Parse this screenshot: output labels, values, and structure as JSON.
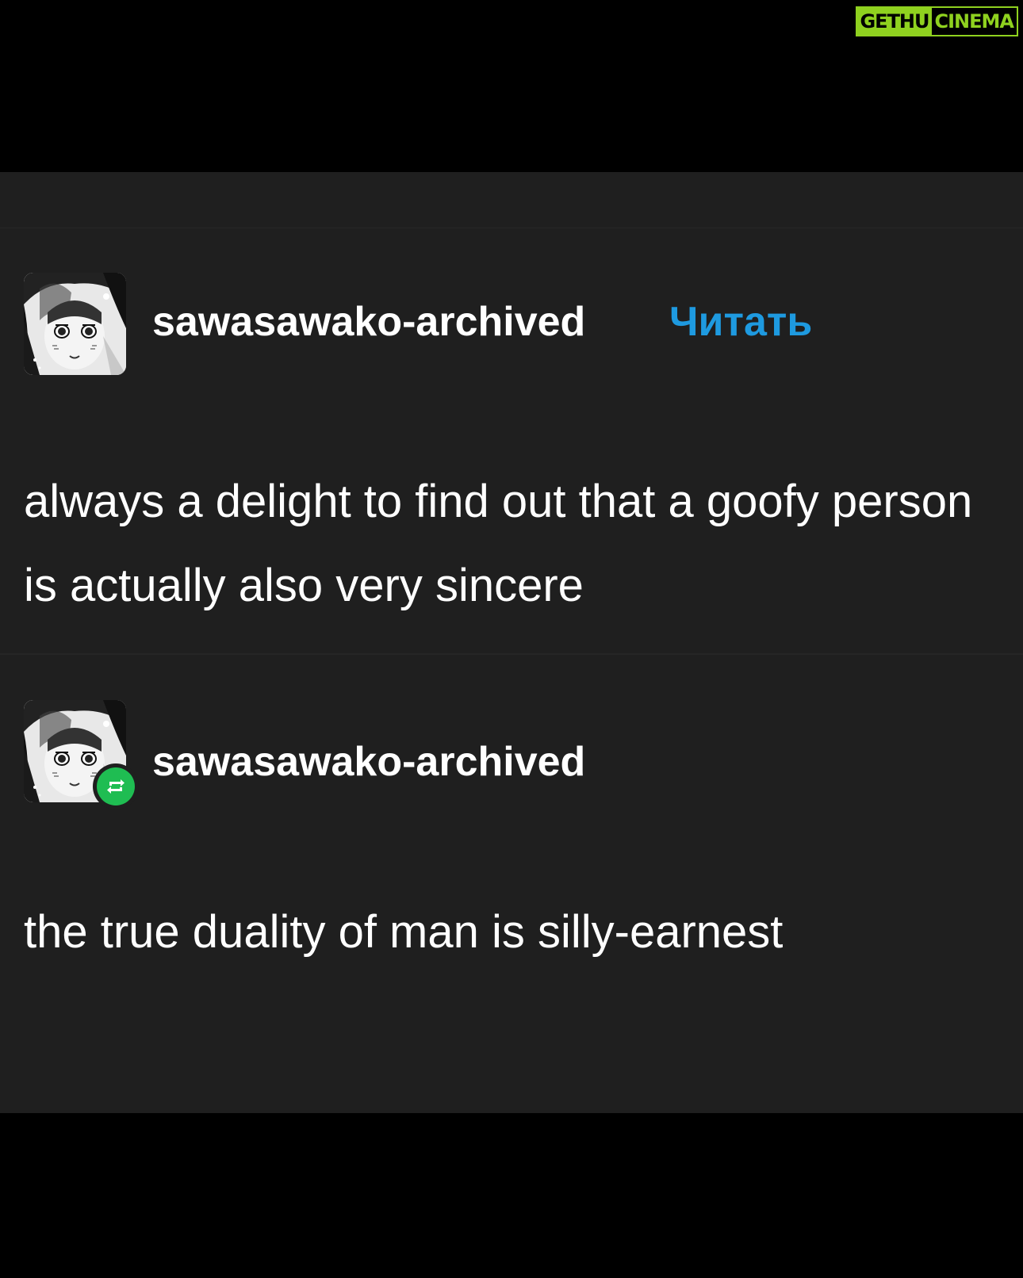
{
  "watermark": {
    "left": "GETHU",
    "right": "CINEMA"
  },
  "posts": [
    {
      "avatar_icon": "manga-avatar-icon",
      "username": "sawasawako-archived",
      "follow_label": "Читать",
      "text": "always a delight to find out that a goofy person is actually also very sincere"
    },
    {
      "avatar_icon": "manga-avatar-icon",
      "reblog_icon": "reblog-icon",
      "username": "sawasawako-archived",
      "text": "the true duality of man is silly-earnest"
    }
  ],
  "colors": {
    "background": "#000000",
    "panel": "#1f1f1f",
    "follow_accent": "#1e9ae0",
    "reblog_badge": "#1fbd52",
    "watermark_green": "#8fd11f"
  }
}
